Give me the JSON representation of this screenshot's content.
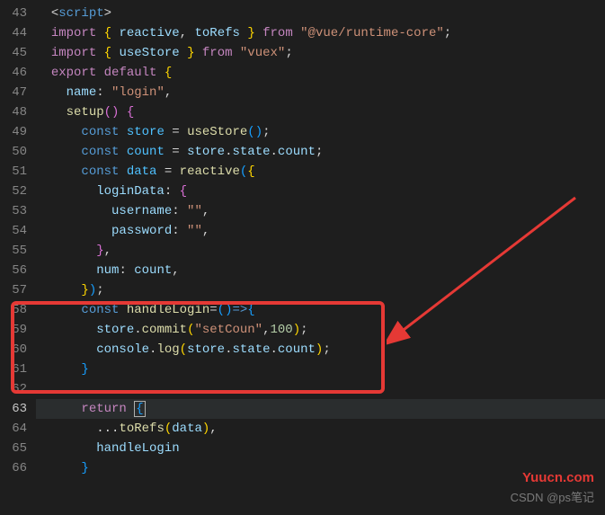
{
  "lines": {
    "start": 43,
    "end": 66,
    "active": 63
  },
  "code": {
    "l43": {
      "tag": "script"
    },
    "l44": {
      "kw1": "import",
      "br1": "{",
      "v1": "reactive",
      "c": ",",
      "v2": "toRefs",
      "br2": "}",
      "kw2": "from",
      "str": "\"@vue/runtime-core\"",
      "semi": ";"
    },
    "l45": {
      "kw1": "import",
      "br1": "{",
      "v1": "useStore",
      "br2": "}",
      "kw2": "from",
      "str": "\"vuex\"",
      "semi": ";"
    },
    "l46": {
      "kw1": "export",
      "kw2": "default",
      "br": "{"
    },
    "l47": {
      "key": "name",
      "colon": ":",
      "str": "\"login\"",
      "c": ","
    },
    "l48": {
      "fn": "setup",
      "p": "()",
      "br": "{"
    },
    "l49": {
      "kw": "const",
      "v": "store",
      "eq": "=",
      "fn": "useStore",
      "p": "()",
      "semi": ";"
    },
    "l50": {
      "kw": "const",
      "v": "count",
      "eq": "=",
      "o1": "store",
      "d1": ".",
      "o2": "state",
      "d2": ".",
      "o3": "count",
      "semi": ";"
    },
    "l51": {
      "kw": "const",
      "v": "data",
      "eq": "=",
      "fn": "reactive",
      "p1": "(",
      "br": "{"
    },
    "l52": {
      "key": "loginData",
      "colon": ":",
      "br": "{"
    },
    "l53": {
      "key": "username",
      "colon": ":",
      "str": "\"\"",
      "c": ","
    },
    "l54": {
      "key": "password",
      "colon": ":",
      "str": "\"\"",
      "c": ","
    },
    "l55": {
      "br": "}",
      "c": ","
    },
    "l56": {
      "key": "num",
      "colon": ":",
      "v": "count",
      "c": ","
    },
    "l57": {
      "br": "}",
      "p": ")",
      "semi": ";"
    },
    "l58": {
      "kw": "const",
      "fn": "handleLogin",
      "eq": "=",
      "p1": "(",
      "p2": ")",
      "arrow": "=>",
      "br": "{"
    },
    "l59": {
      "o": "store",
      "d": ".",
      "fn": "commit",
      "p1": "(",
      "str": "\"setCoun\"",
      "c": ",",
      "num": "100",
      "p2": ")",
      "semi": ";"
    },
    "l60": {
      "o1": "console",
      "d1": ".",
      "fn": "log",
      "p1": "(",
      "o2": "store",
      "d2": ".",
      "o3": "state",
      "d3": ".",
      "o4": "count",
      "p2": ")",
      "semi": ";"
    },
    "l61": {
      "br": "}"
    },
    "l63": {
      "kw": "return",
      "br": "{"
    },
    "l64": {
      "spread": "...",
      "fn": "toRefs",
      "p1": "(",
      "v": "data",
      "p2": ")",
      "c": ","
    },
    "l65": {
      "v": "handleLogin"
    },
    "l66": {
      "br": "}"
    }
  },
  "watermarks": {
    "w1": "Yuucn.com",
    "w2": "CSDN @ps笔记"
  }
}
